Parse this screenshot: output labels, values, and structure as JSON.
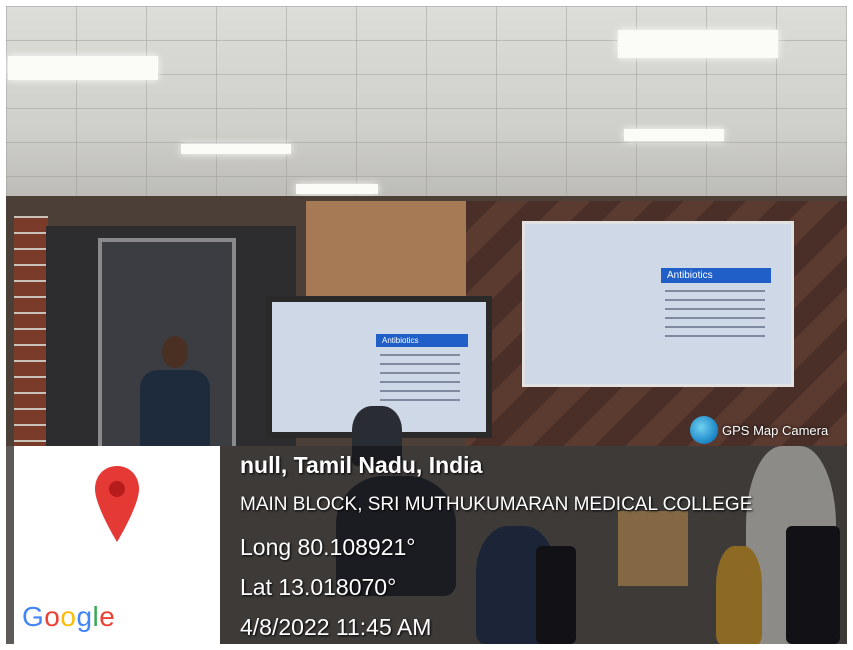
{
  "slides": {
    "heading": "Antibiotics"
  },
  "badge": {
    "label": "GPS Map Camera"
  },
  "location": {
    "place": "null, Tamil Nadu, India",
    "address": "MAIN BLOCK, SRI MUTHUKUMARAN MEDICAL COLLEGE",
    "longitude": "Long 80.108921°",
    "latitude": "Lat 13.018070°",
    "timestamp": "4/8/2022 11:45 AM"
  },
  "map": {
    "logo_text": "Google",
    "pin_color": "#e53935",
    "logo_colors": [
      "#4285F4",
      "#EA4335",
      "#FBBC05",
      "#4285F4",
      "#34A853",
      "#EA4335"
    ]
  }
}
